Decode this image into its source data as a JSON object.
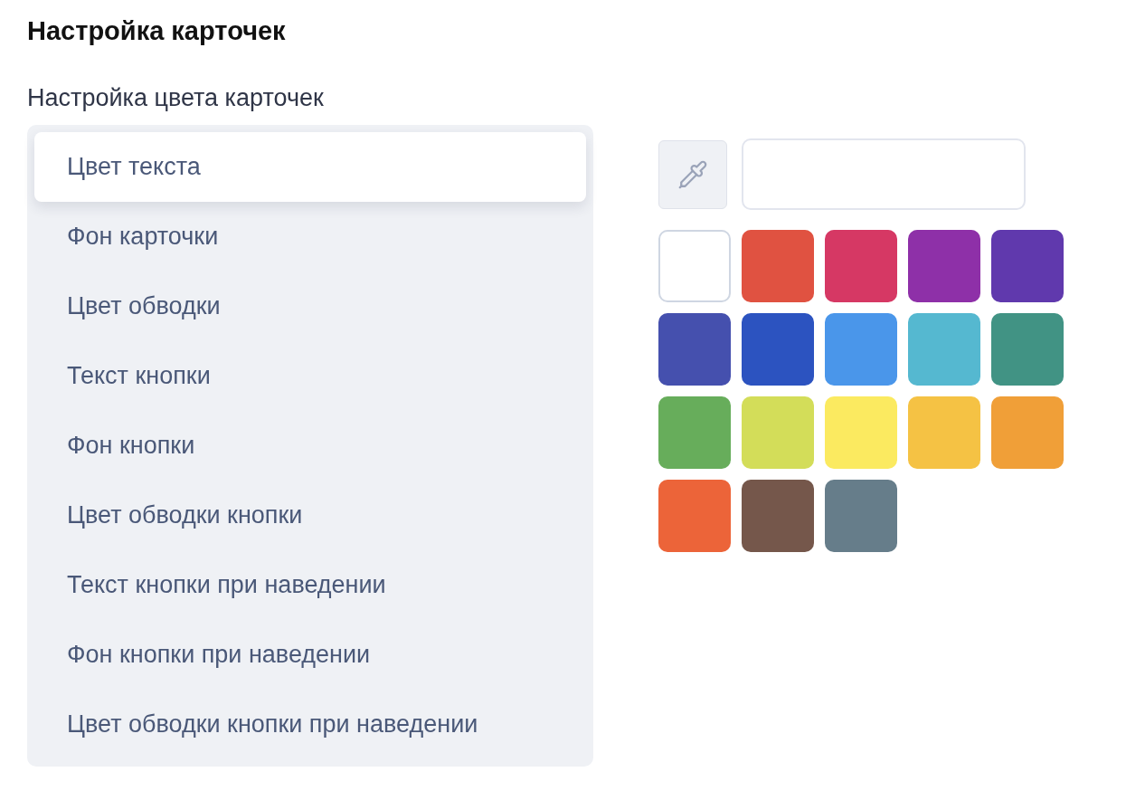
{
  "title": "Настройка карточек",
  "section": {
    "label": "Настройка цвета карточек",
    "items": [
      {
        "label": "Цвет текста",
        "selected": true
      },
      {
        "label": "Фон карточки",
        "selected": false
      },
      {
        "label": "Цвет обводки",
        "selected": false
      },
      {
        "label": "Текст кнопки",
        "selected": false
      },
      {
        "label": "Фон кнопки",
        "selected": false
      },
      {
        "label": "Цвет обводки кнопки",
        "selected": false
      },
      {
        "label": "Текст кнопки при наведении",
        "selected": false
      },
      {
        "label": "Фон кнопки при наведении",
        "selected": false
      },
      {
        "label": "Цвет обводки кнопки при наведении",
        "selected": false
      }
    ]
  },
  "palette": {
    "swatches": [
      {
        "color": "#ffffff"
      },
      {
        "color": "#e05241"
      },
      {
        "color": "#d63864"
      },
      {
        "color": "#8e30a8"
      },
      {
        "color": "#6039ad"
      },
      {
        "color": "#4550ae"
      },
      {
        "color": "#2c53c0"
      },
      {
        "color": "#4a96ea"
      },
      {
        "color": "#55b8d0"
      },
      {
        "color": "#419384"
      },
      {
        "color": "#67ad5b"
      },
      {
        "color": "#d3dd59"
      },
      {
        "color": "#fbea60"
      },
      {
        "color": "#f5c244"
      },
      {
        "color": "#f09f38"
      },
      {
        "color": "#ec6439"
      },
      {
        "color": "#75574b"
      },
      {
        "color": "#667d8a"
      }
    ]
  }
}
